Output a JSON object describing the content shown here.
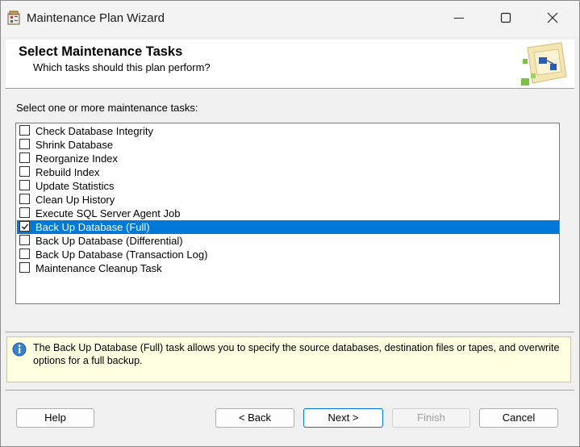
{
  "window": {
    "title": "Maintenance Plan Wizard"
  },
  "header": {
    "title": "Select Maintenance Tasks",
    "subtitle": "Which tasks should this plan perform?"
  },
  "instruction": "Select one or more maintenance tasks:",
  "tasks": [
    {
      "label": "Check Database Integrity",
      "checked": false,
      "selected": false
    },
    {
      "label": "Shrink Database",
      "checked": false,
      "selected": false
    },
    {
      "label": "Reorganize Index",
      "checked": false,
      "selected": false
    },
    {
      "label": "Rebuild Index",
      "checked": false,
      "selected": false
    },
    {
      "label": "Update Statistics",
      "checked": false,
      "selected": false
    },
    {
      "label": "Clean Up History",
      "checked": false,
      "selected": false
    },
    {
      "label": "Execute SQL Server Agent Job",
      "checked": false,
      "selected": false
    },
    {
      "label": "Back Up Database (Full)",
      "checked": true,
      "selected": true
    },
    {
      "label": "Back Up Database (Differential)",
      "checked": false,
      "selected": false
    },
    {
      "label": "Back Up Database (Transaction Log)",
      "checked": false,
      "selected": false
    },
    {
      "label": "Maintenance Cleanup Task",
      "checked": false,
      "selected": false
    }
  ],
  "info": {
    "text": "The Back Up Database (Full) task allows you to specify the source databases, destination files or tapes, and overwrite options for a full backup."
  },
  "buttons": {
    "help": "Help",
    "back": "< Back",
    "next": "Next >",
    "finish": "Finish",
    "cancel": "Cancel"
  },
  "colors": {
    "selection": "#0078d7",
    "info_background": "#ffffe1"
  }
}
